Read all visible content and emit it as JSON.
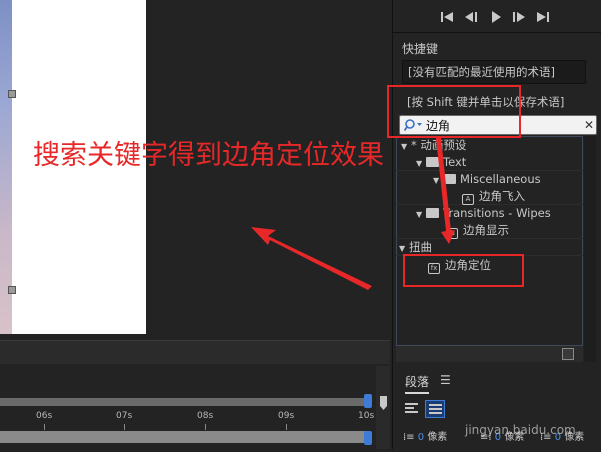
{
  "transport": {
    "first_icon": "skip-to-start-icon",
    "prev_icon": "step-back-icon",
    "play_icon": "play-icon",
    "next_icon": "step-forward-icon",
    "last_icon": "skip-to-end-icon"
  },
  "shortcut": {
    "label": "快捷键",
    "recent_value": "[没有匹配的最近使用的术语]",
    "hint": "[按 Shift 键并单击以保存术语]"
  },
  "search": {
    "value": "边角",
    "placeholder": ""
  },
  "tree": {
    "rows": [
      {
        "label": "* 动画预设",
        "level": 0
      },
      {
        "label": "Text",
        "level": 1
      },
      {
        "label": "Miscellaneous",
        "level": 2
      },
      {
        "label": "边角飞入",
        "level": 3
      },
      {
        "label": "Transitions - Wipes",
        "level": 1
      },
      {
        "label": "边角显示",
        "level": 2
      },
      {
        "label": "扭曲",
        "level": 0
      },
      {
        "label": "边角定位",
        "level": 1
      }
    ]
  },
  "timeline": {
    "ticks": [
      "06s",
      "07s",
      "08s",
      "09s",
      "10s"
    ]
  },
  "paragraph": {
    "tab_label": "段落",
    "fields": [
      {
        "value": "0",
        "unit": "像素"
      },
      {
        "value": "0",
        "unit": "像素"
      },
      {
        "value": "0",
        "unit": "像素"
      }
    ]
  },
  "annotation": {
    "text": "搜索关键字得到边角定位效果",
    "color": "#e82828"
  },
  "watermark": "jingyan.baidu.com",
  "colors": {
    "accent": "#3d7bd6",
    "annotation": "#e82828"
  }
}
